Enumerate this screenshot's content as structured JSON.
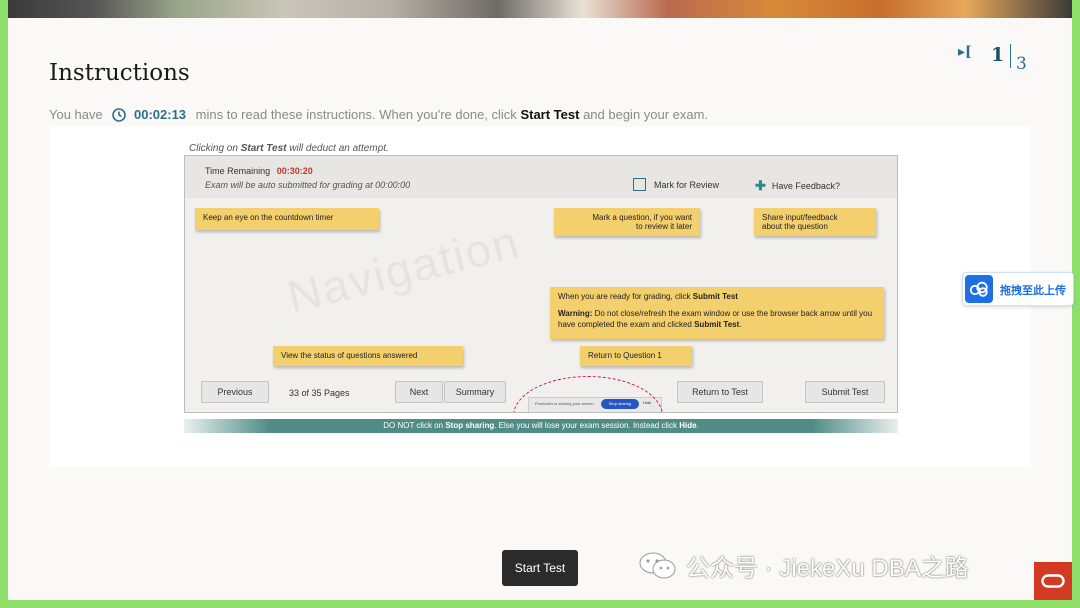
{
  "page": {
    "title": "Instructions",
    "pager": {
      "current": "1",
      "total": "3",
      "icon": "collapse-bracket-icon"
    }
  },
  "timer": {
    "prefix": "You have",
    "time": "00:02:13",
    "middle": "mins to read these instructions. When you're done, click",
    "action": "Start Test",
    "suffix": "and begin your exam.",
    "icon": "clock-icon"
  },
  "panel": {
    "note_prefix": "Clicking on",
    "note_bold": "Start Test",
    "note_suffix": "will deduct an attempt.",
    "screenshot": {
      "time_remaining_label": "Time Remaining",
      "time_remaining_value": "00:30:20",
      "auto_submit_note": "Exam will be auto submitted for grading at 00:00:00",
      "mark_for_review": "Mark for Review",
      "have_feedback": "Have Feedback?",
      "watermark": "Navigation",
      "stickies": {
        "countdown": "Keep an eye on the countdown timer",
        "mark_line1": "Mark a question, if you want",
        "mark_line2": "to review it later",
        "share_line1": "Share input/feedback",
        "share_line2": "about the question",
        "ready_prefix": "When you are ready for grading, click",
        "ready_bold": "Submit Test",
        "warning_label": "Warning:",
        "warning_text": "Do not close/refresh the exam window or use the browser back arrow until you have completed the exam and clicked",
        "warning_bold": "Submit Test",
        "view_status": "View the status of questions answered",
        "return_question": "Return to Question 1"
      },
      "nav": {
        "previous": "Previous",
        "pages": "33 of 35 Pages",
        "next": "Next",
        "summary": "Summary",
        "return_to_test": "Return to Test",
        "submit_test": "Submit Test"
      },
      "share_bar": {
        "text": "Proctortrix is sharing your screen.",
        "stop": "Stop sharing",
        "hide": "Hide"
      }
    },
    "footer_prefix": "DO NOT click on",
    "footer_bold1": "Stop sharing",
    "footer_middle": ". Else you will lose your exam session. Instead click",
    "footer_bold2": "Hide",
    "footer_end": "."
  },
  "start_button": {
    "label": "Start Test"
  },
  "upload_widget": {
    "label": "拖拽至此上传",
    "icon": "cloud-upload-icon"
  },
  "watermark_text": {
    "icon": "wechat-icon",
    "text": "公众号 · JiekeXu DBA之路"
  },
  "oracle_logo": {
    "icon": "oracle-logo-icon"
  },
  "colors": {
    "accent": "#2a6f90",
    "sticky": "#f4cf6e",
    "red": "#c0392b",
    "frame": "#8ee06a"
  }
}
